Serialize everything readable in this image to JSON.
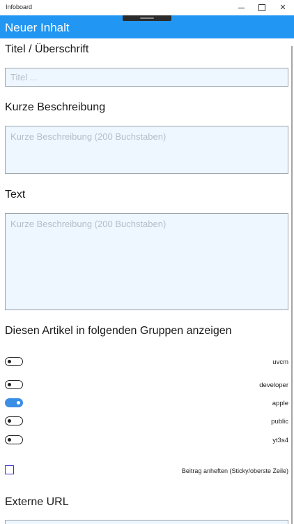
{
  "window": {
    "title": "Infoboard"
  },
  "header": {
    "title": "Neuer Inhalt"
  },
  "form": {
    "title_label": "Titel / Überschrift",
    "title_placeholder": "Titel ...",
    "short_desc_label": "Kurze Beschreibung",
    "short_desc_placeholder": "Kurze Beschreibung (200 Buchstaben)",
    "text_label": "Text",
    "text_placeholder": "Kurze Beschreibung (200 Buchstaben)",
    "groups_label": "Diesen Artikel in folgenden Gruppen anzeigen",
    "groups": [
      {
        "name": "uvcm",
        "on": false
      },
      {
        "name": "developer",
        "on": false
      },
      {
        "name": "apple",
        "on": true
      },
      {
        "name": "public",
        "on": false
      },
      {
        "name": "yt3s4",
        "on": false
      }
    ],
    "pin_label": "Beitrag anheften (Sticky/oberste Zeile)",
    "pin_checked": false,
    "url_label": "Externe URL"
  },
  "colors": {
    "accent": "#2196f3",
    "toggle_on": "#3a8ee6",
    "field_bg": "#eef6ff"
  }
}
